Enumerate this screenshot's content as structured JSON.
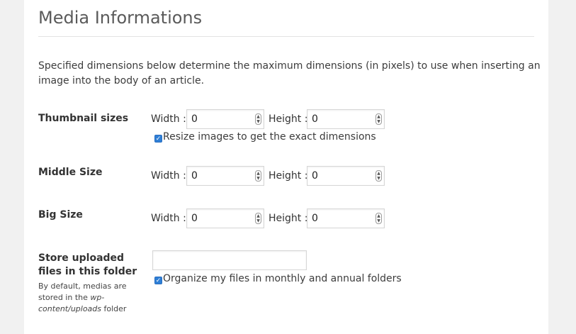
{
  "section": {
    "title": "Media Informations",
    "description": "Specified dimensions below determine the maximum dimensions (in pixels) to use when inserting an image into the body of an article."
  },
  "rows": [
    {
      "label": "Thumbnail sizes",
      "width_label": "Width :",
      "width_value": "0",
      "height_label": "Height :",
      "height_value": "0",
      "checkbox": {
        "label": "Resize images to get the exact dimensions",
        "checked": true
      }
    },
    {
      "label": "Middle Size",
      "width_label": "Width :",
      "width_value": "0",
      "height_label": "Height :",
      "height_value": "0"
    },
    {
      "label": "Big Size",
      "width_label": "Width :",
      "width_value": "0",
      "height_label": "Height :",
      "height_value": "0"
    }
  ],
  "upload": {
    "label": "Store uploaded files in this folder",
    "value": "",
    "hint_prefix": "By default, medias are stored in the ",
    "hint_path": "wp-content/uploads",
    "hint_suffix": " folder",
    "checkbox": {
      "label": "Organize my files in monthly and annual folders",
      "checked": true
    }
  },
  "colors": {
    "checkbox": "#2f7fd6",
    "panel": "#ffffff",
    "background": "#f1f1f1"
  }
}
